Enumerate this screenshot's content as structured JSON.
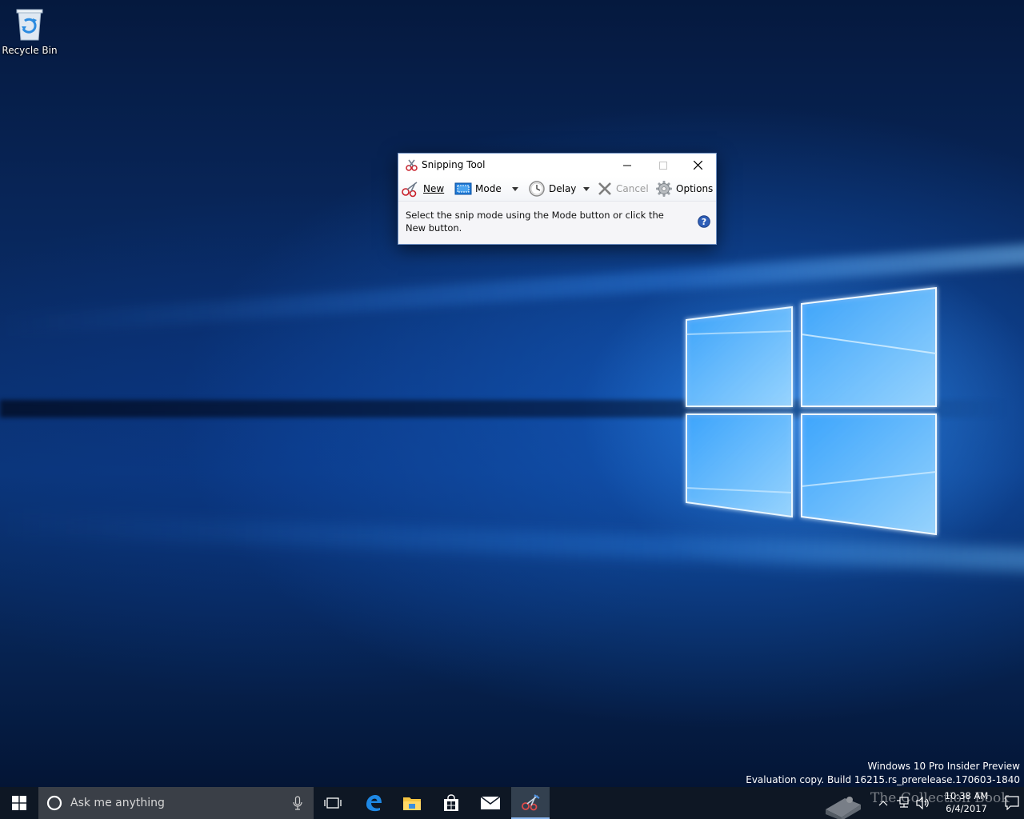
{
  "desktop": {
    "icons": [
      {
        "label": "Recycle Bin",
        "icon": "recycle-bin-icon"
      }
    ]
  },
  "snipping_tool": {
    "title": "Snipping Tool",
    "toolbar": {
      "new_label": "New",
      "mode_label": "Mode",
      "delay_label": "Delay",
      "cancel_label": "Cancel",
      "options_label": "Options"
    },
    "message": "Select the snip mode using the Mode button or click the New button."
  },
  "watermark": {
    "line1": "Windows 10 Pro Insider Preview",
    "line2": "Evaluation copy. Build 16215.rs_prerelease.170603-1840"
  },
  "taskbar": {
    "search_placeholder": "Ask me anything",
    "pinned_apps": [
      "task-view",
      "edge",
      "file-explorer",
      "store",
      "mail",
      "snipping-tool"
    ],
    "active_app": "snipping-tool",
    "clock": {
      "time": "10:38 AM",
      "date": "6/4/2017"
    },
    "overlay_text": "The Collection Book"
  },
  "colors": {
    "taskbar_bg": "#0e1724",
    "search_bg": "#3a3f47",
    "active_indicator": "#8ab6ee",
    "wallpaper_accent": "#1a78e6"
  }
}
